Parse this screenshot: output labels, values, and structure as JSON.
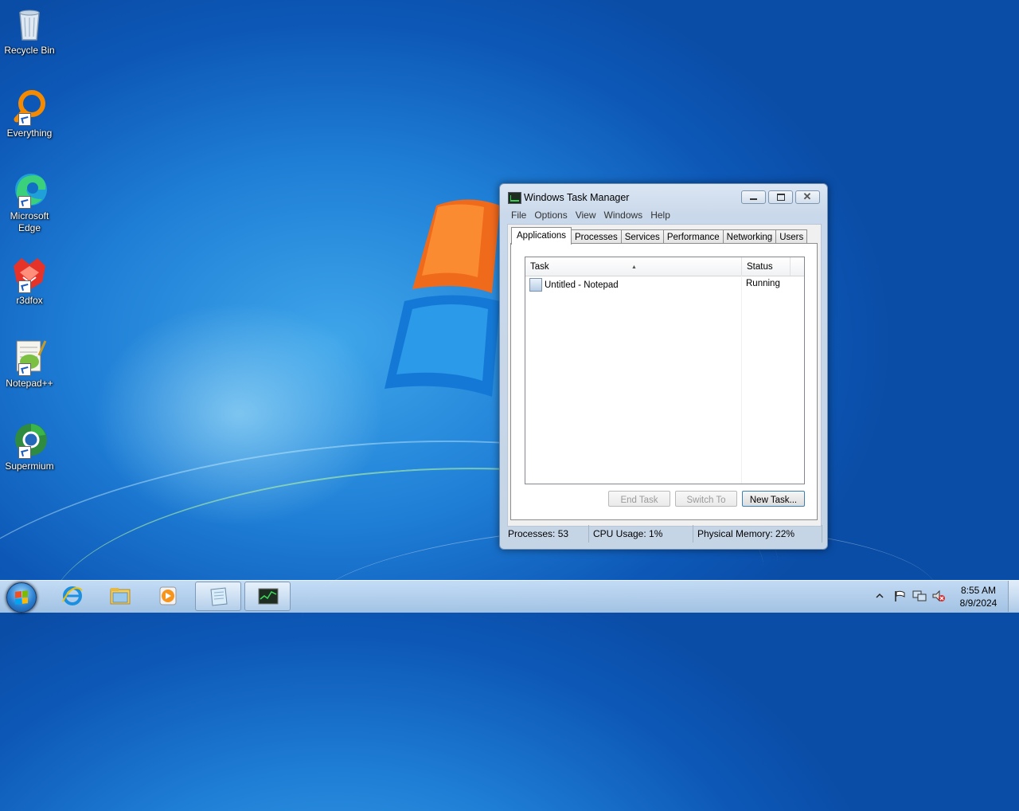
{
  "desktop": {
    "icons": [
      {
        "label": "Recycle Bin",
        "icon": "recycle-bin-icon"
      },
      {
        "label": "Everything",
        "icon": "everything-search-icon"
      },
      {
        "label": "Microsoft Edge",
        "icon": "edge-browser-icon"
      },
      {
        "label": "r3dfox",
        "icon": "r3dfox-browser-icon"
      },
      {
        "label": "Notepad++",
        "icon": "notepadplusplus-icon"
      },
      {
        "label": "Supermium",
        "icon": "supermium-browser-icon"
      }
    ]
  },
  "task_manager": {
    "title": "Windows Task Manager",
    "menu": [
      "File",
      "Options",
      "View",
      "Windows",
      "Help"
    ],
    "tabs": [
      "Applications",
      "Processes",
      "Services",
      "Performance",
      "Networking",
      "Users"
    ],
    "active_tab": "Applications",
    "columns": {
      "task": "Task",
      "status": "Status"
    },
    "rows": [
      {
        "task": "Untitled - Notepad",
        "status": "Running"
      }
    ],
    "buttons": {
      "end_task": "End Task",
      "switch_to": "Switch To",
      "new_task": "New Task..."
    },
    "status_bar": {
      "processes": "Processes: 53",
      "cpu": "CPU Usage: 1%",
      "memory": "Physical Memory: 22%"
    }
  },
  "taskbar": {
    "pinned": [
      "internet-explorer-icon",
      "file-explorer-icon",
      "media-player-icon",
      "notepad-icon",
      "task-manager-icon"
    ],
    "clock": {
      "time": "8:55 AM",
      "date": "8/9/2024"
    }
  },
  "colors": {
    "desktop_blue": "#1f7fd6",
    "window_frame": "#c9d8ea",
    "taskbar": "#bcd3ea"
  }
}
